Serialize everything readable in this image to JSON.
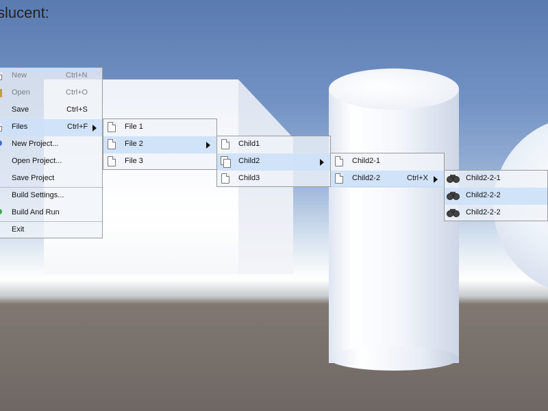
{
  "heading": "slucent:",
  "main_menu": {
    "items": [
      {
        "label": "New",
        "shortcut": "Ctrl+N"
      },
      {
        "label": "Open",
        "shortcut": "Ctrl+O"
      },
      {
        "label": "Save",
        "shortcut": "Ctrl+S"
      },
      {
        "label": "Files",
        "shortcut": "Ctrl+F"
      },
      {
        "label": "New Project..."
      },
      {
        "label": "Open Project..."
      },
      {
        "label": "Save Project"
      },
      {
        "label": "Build Settings..."
      },
      {
        "label": "Build And Run"
      },
      {
        "label": "Exit"
      }
    ]
  },
  "files_menu": {
    "items": [
      {
        "label": "File 1"
      },
      {
        "label": "File 2"
      },
      {
        "label": "File 3"
      }
    ]
  },
  "file2_menu": {
    "items": [
      {
        "label": "Child1"
      },
      {
        "label": "Child2"
      },
      {
        "label": "Child3"
      }
    ]
  },
  "child2_menu": {
    "items": [
      {
        "label": "Child2-1"
      },
      {
        "label": "Child2-2",
        "shortcut": "Ctrl+X"
      }
    ]
  },
  "child22_menu": {
    "items": [
      {
        "label": "Child2-2-1"
      },
      {
        "label": "Child2-2-2"
      },
      {
        "label": "Child2-2-2"
      }
    ]
  },
  "colors": {
    "highlight": "#cde1f8",
    "menu_bg": "#f0f3f8",
    "sky": "#5a7bb0",
    "ground": "#6e6764"
  }
}
